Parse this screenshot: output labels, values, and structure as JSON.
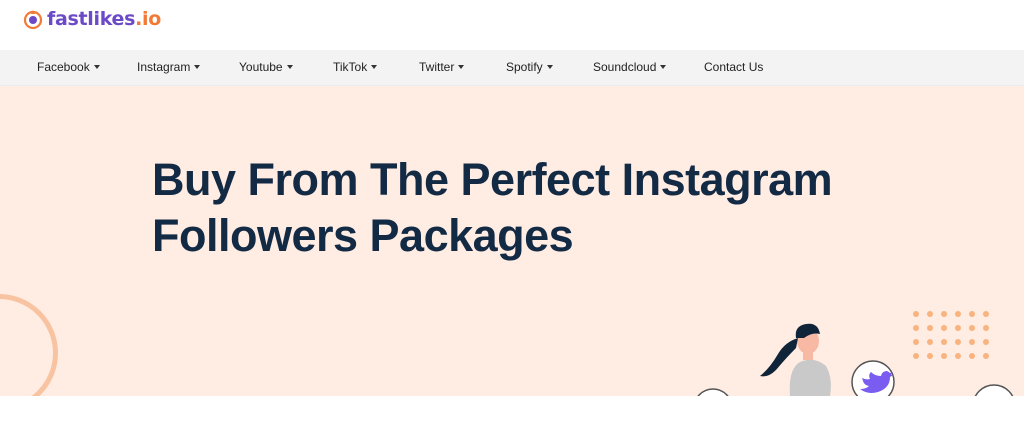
{
  "brand": {
    "name": "fastlikes",
    "tld": ".io"
  },
  "nav": {
    "items": [
      {
        "label": "Facebook",
        "dropdown": true
      },
      {
        "label": "Instagram",
        "dropdown": true
      },
      {
        "label": "Youtube",
        "dropdown": true
      },
      {
        "label": "TikTok",
        "dropdown": true
      },
      {
        "label": "Twitter",
        "dropdown": true
      },
      {
        "label": "Spotify",
        "dropdown": true
      },
      {
        "label": "Soundcloud",
        "dropdown": true
      },
      {
        "label": "Contact Us",
        "dropdown": false
      }
    ]
  },
  "hero": {
    "title_line1": "Buy From The Perfect Instagram",
    "title_line2": "Followers Packages"
  },
  "colors": {
    "hero_bg": "#ffece3",
    "title": "#132a45",
    "brand_purple": "#6b49c7",
    "brand_orange": "#f07a36",
    "accent_ring": "#f8c3a0",
    "dot": "#f8b37f",
    "twitter_bird": "#7a5cf0"
  },
  "icons": [
    "logo-mark-icon",
    "chevron-down-icon",
    "twitter-bird-icon"
  ]
}
